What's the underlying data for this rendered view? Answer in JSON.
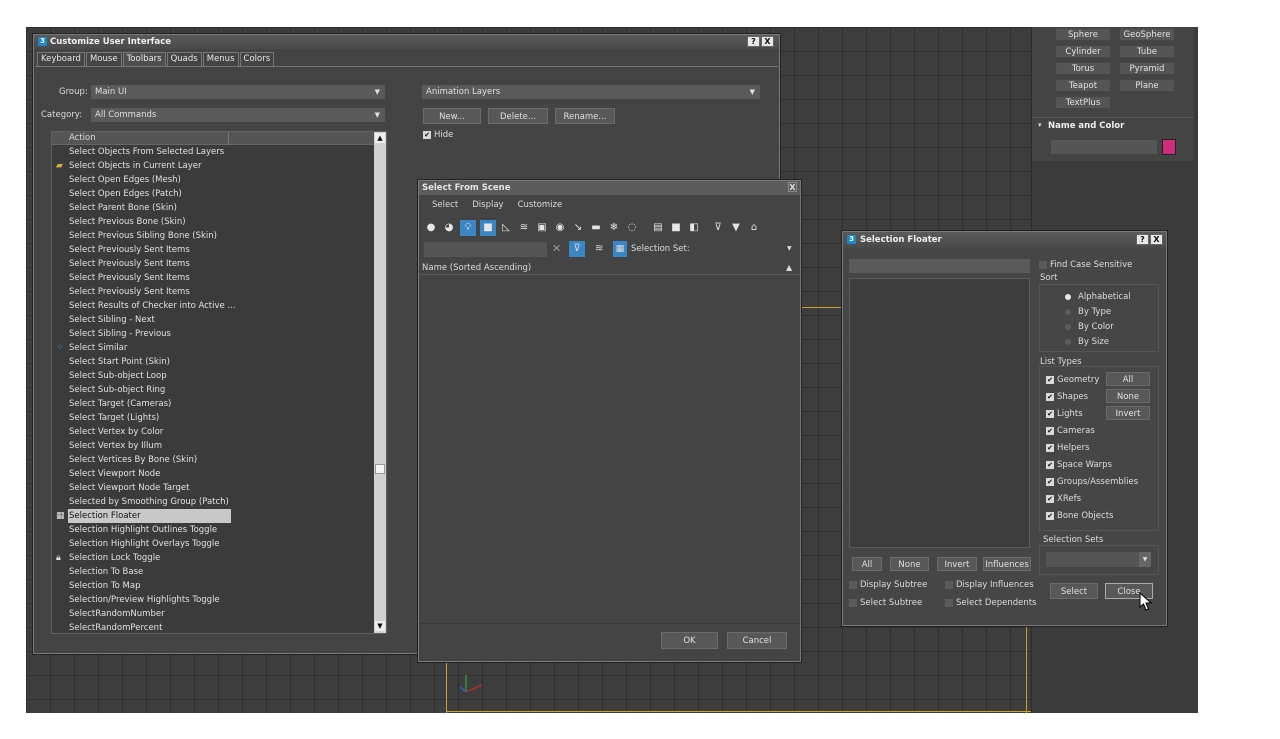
{
  "command_panel": {
    "object_buttons": [
      "Sphere",
      "GeoSphere",
      "Cylinder",
      "Tube",
      "Torus",
      "Pyramid",
      "Teapot",
      "Plane",
      "TextPlus"
    ],
    "name_color_title": "Name and Color",
    "swatch_color": "#d02c7c"
  },
  "customize": {
    "title": "Customize User Interface",
    "help": "?",
    "close": "X",
    "tabs": [
      "Keyboard",
      "Mouse",
      "Toolbars",
      "Quads",
      "Menus",
      "Colors"
    ],
    "group_label": "Group:",
    "group_value": "Main UI",
    "category_label": "Category:",
    "category_value": "All Commands",
    "column_action": "Action",
    "toolbar_select": "Animation Layers",
    "new_label": "New...",
    "delete_label": "Delete...",
    "rename_label": "Rename...",
    "hide_label": "Hide",
    "actions": [
      "Select Objects From Selected Layers",
      "Select Objects in Current Layer",
      "Select Open Edges (Mesh)",
      "Select Open Edges (Patch)",
      "Select Parent Bone (Skin)",
      "Select Previous Bone (Skin)",
      "Select Previous Sibling Bone (Skin)",
      "Select Previously Sent Items",
      "Select Previously Sent Items",
      "Select Previously Sent Items",
      "Select Previously Sent Items",
      "Select Results of Checker into Active ...",
      "Select Sibling - Next",
      "Select Sibling - Previous",
      "Select Similar",
      "Select Start Point (Skin)",
      "Select Sub-object Loop",
      "Select Sub-object Ring",
      "Select Target (Cameras)",
      "Select Target (Lights)",
      "Select Vertex by Color",
      "Select Vertex by Illum",
      "Select Vertices By Bone (Skin)",
      "Select Viewport Node",
      "Select Viewport Node Target",
      "Selected by Smoothing Group (Patch)",
      "Selection Floater",
      "Selection Highlight Outlines Toggle",
      "Selection Highlight Overlays Toggle",
      "Selection Lock Toggle",
      "Selection To Base",
      "Selection To Map",
      "Selection/Preview Highlights Toggle",
      "SelectRandomNumber",
      "SelectRandomPercent"
    ]
  },
  "scene": {
    "title": "Select From Scene",
    "close": "X",
    "menu": [
      "Select",
      "Display",
      "Customize"
    ],
    "selection_set_label": "Selection Set:",
    "column": "Name (Sorted Ascending)",
    "ok": "OK",
    "cancel": "Cancel"
  },
  "floater": {
    "title": "Selection Floater",
    "help": "?",
    "close": "X",
    "find_case": "Find Case Sensitive",
    "sort_label": "Sort",
    "sort_options": [
      "Alphabetical",
      "By Type",
      "By Color",
      "By Size"
    ],
    "list_types_label": "List Types",
    "types": [
      "Geometry",
      "Shapes",
      "Lights",
      "Cameras",
      "Helpers",
      "Space Warps",
      "Groups/Assemblies",
      "XRefs",
      "Bone Objects"
    ],
    "all": "All",
    "none": "None",
    "invert": "Invert",
    "influences": "Influences",
    "selection_sets_label": "Selection Sets",
    "display_subtree": "Display Subtree",
    "display_influences": "Display Influences",
    "select_subtree": "Select Subtree",
    "select_dependents": "Select Dependents",
    "select_btn": "Select",
    "close_btn": "Close"
  }
}
